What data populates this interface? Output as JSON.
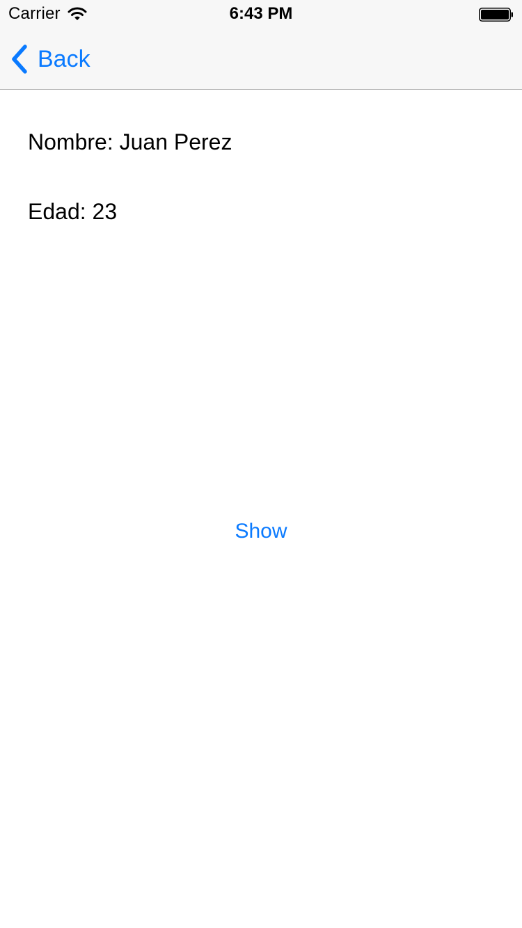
{
  "status_bar": {
    "carrier": "Carrier",
    "time": "6:43 PM",
    "wifi_icon": "wifi-icon",
    "battery_icon": "battery-icon",
    "battery_level": 1.0
  },
  "nav_bar": {
    "back_label": "Back",
    "back_icon": "chevron-left-icon"
  },
  "detail": {
    "name_text": "Nombre: Juan Perez",
    "age_text": "Edad: 23"
  },
  "actions": {
    "show_label": "Show"
  },
  "colors": {
    "accent": "#0a7aff",
    "bar_background": "#f7f7f7",
    "separator": "#b2b2b2",
    "text": "#000000"
  }
}
